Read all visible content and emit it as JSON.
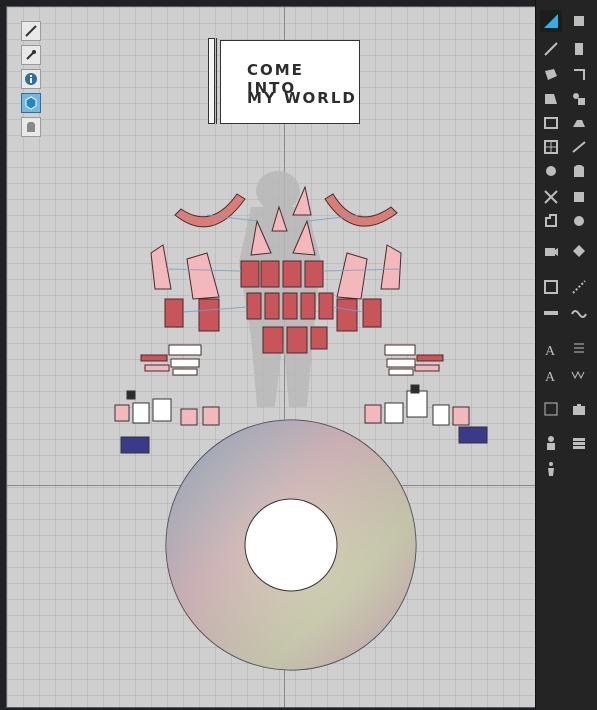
{
  "title_card": {
    "line1": "COME INTO",
    "line2": "MY WORLD"
  },
  "left_toolbar": {
    "items": [
      {
        "name": "wrench-tool-icon"
      },
      {
        "name": "eye-dropper-tool-icon"
      },
      {
        "name": "info-tool-icon"
      },
      {
        "name": "cube-tool-icon",
        "active": true
      },
      {
        "name": "shirt-tool-icon"
      }
    ]
  },
  "right_toolbar": {
    "columns": [
      [
        "select-tool-icon",
        "transform-tool-icon",
        "box-tool-icon",
        "segment-tool-icon",
        "rect-tool-icon",
        "grid-tool-icon",
        "dart-tool-icon",
        "cut-tool-icon",
        "notch-tool-icon",
        "sew-tool-icon",
        "seam-tool-icon",
        "ruler-tool-icon",
        "text-tool-icon",
        "text-alt-tool-icon",
        "stitch-tool-icon",
        "avatar-tool-icon",
        "figure-tool-icon"
      ],
      [
        "edit-tool-icon",
        "edit-alt-tool-icon",
        "point-tool-icon",
        "pin-tool-icon",
        "iron-tool-icon",
        "fold-tool-icon",
        "shirt-alt-tool-icon",
        "fabric-tool-icon",
        "button-tool-icon",
        "zipper-tool-icon",
        "line-tool-icon",
        "wave-tool-icon",
        "topstitch-tool-icon",
        "ww-tool-icon",
        "camera-tool-icon",
        "layers-tool-icon"
      ]
    ]
  },
  "colors": {
    "canvas_bg": "#cfcfcf",
    "panel_bg": "#242424",
    "pattern_fill": "#d97d78",
    "pattern_stroke": "#4a2b2b",
    "pattern_light": "#f2b8bc",
    "accent": "#2bb3e6"
  }
}
